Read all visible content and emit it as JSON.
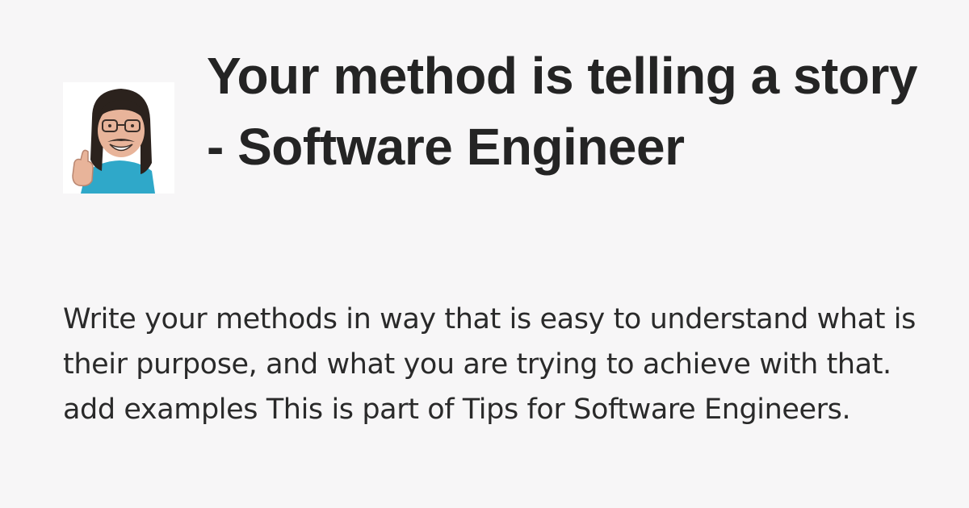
{
  "post": {
    "title": "Your method is telling a story - Software Engineer",
    "description": "Write your methods in way that is easy to understand what is their purpose, and what you are trying to achieve with that. add examples This is part of Tips for Software Engineers."
  },
  "avatar": {
    "icon": "cartoon-avatar-icon",
    "colors": {
      "hair": "#2b221d",
      "skin": "#e8b49a",
      "shirt": "#2fa8c9",
      "background": "#ffffff"
    }
  },
  "colors": {
    "background": "#f7f6f7",
    "text": "#242424"
  }
}
